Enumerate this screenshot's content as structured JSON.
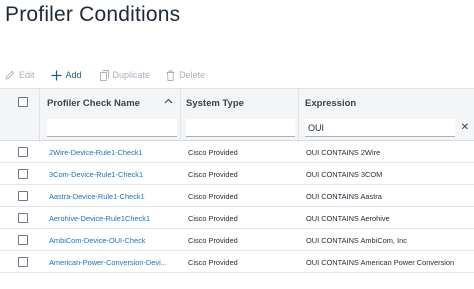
{
  "page": {
    "title": "Profiler Conditions"
  },
  "toolbar": {
    "edit_label": "Edit",
    "add_label": "Add",
    "duplicate_label": "Duplicate",
    "delete_label": "Delete"
  },
  "table": {
    "columns": [
      {
        "label": "Profiler Check Name",
        "filter": ""
      },
      {
        "label": "System Type",
        "filter": ""
      },
      {
        "label": "Expression",
        "filter": "OUI"
      }
    ],
    "rows": [
      {
        "name": "2Wire-Device-Rule1-Check1",
        "type": "Cisco Provided",
        "expression": "OUI CONTAINS 2Wire"
      },
      {
        "name": "3Com-Device-Rule1-Check1",
        "type": "Cisco Provided",
        "expression": "OUI CONTAINS 3COM"
      },
      {
        "name": "Aastra-Device-Rule1-Check1",
        "type": "Cisco Provided",
        "expression": "OUI CONTAINS Aastra"
      },
      {
        "name": "Aerohive-Device-Rule1Check1",
        "type": "Cisco Provided",
        "expression": "OUI CONTAINS Aerohive"
      },
      {
        "name": "AmbiCom-Device-OUI-Check",
        "type": "Cisco Provided",
        "expression": "OUI CONTAINS AmbiCom, Inc"
      },
      {
        "name": "American-Power-Conversion-Devi...",
        "type": "Cisco Provided",
        "expression": "OUI CONTAINS American Power Conversion"
      }
    ]
  },
  "colors": {
    "link": "#1e72b5",
    "accent": "#1d5d8a",
    "disabled": "#a7b1bb"
  },
  "icons": [
    "pencil-icon",
    "plus-icon",
    "copy-icon",
    "trash-icon",
    "sort-up-icon",
    "close-icon"
  ]
}
